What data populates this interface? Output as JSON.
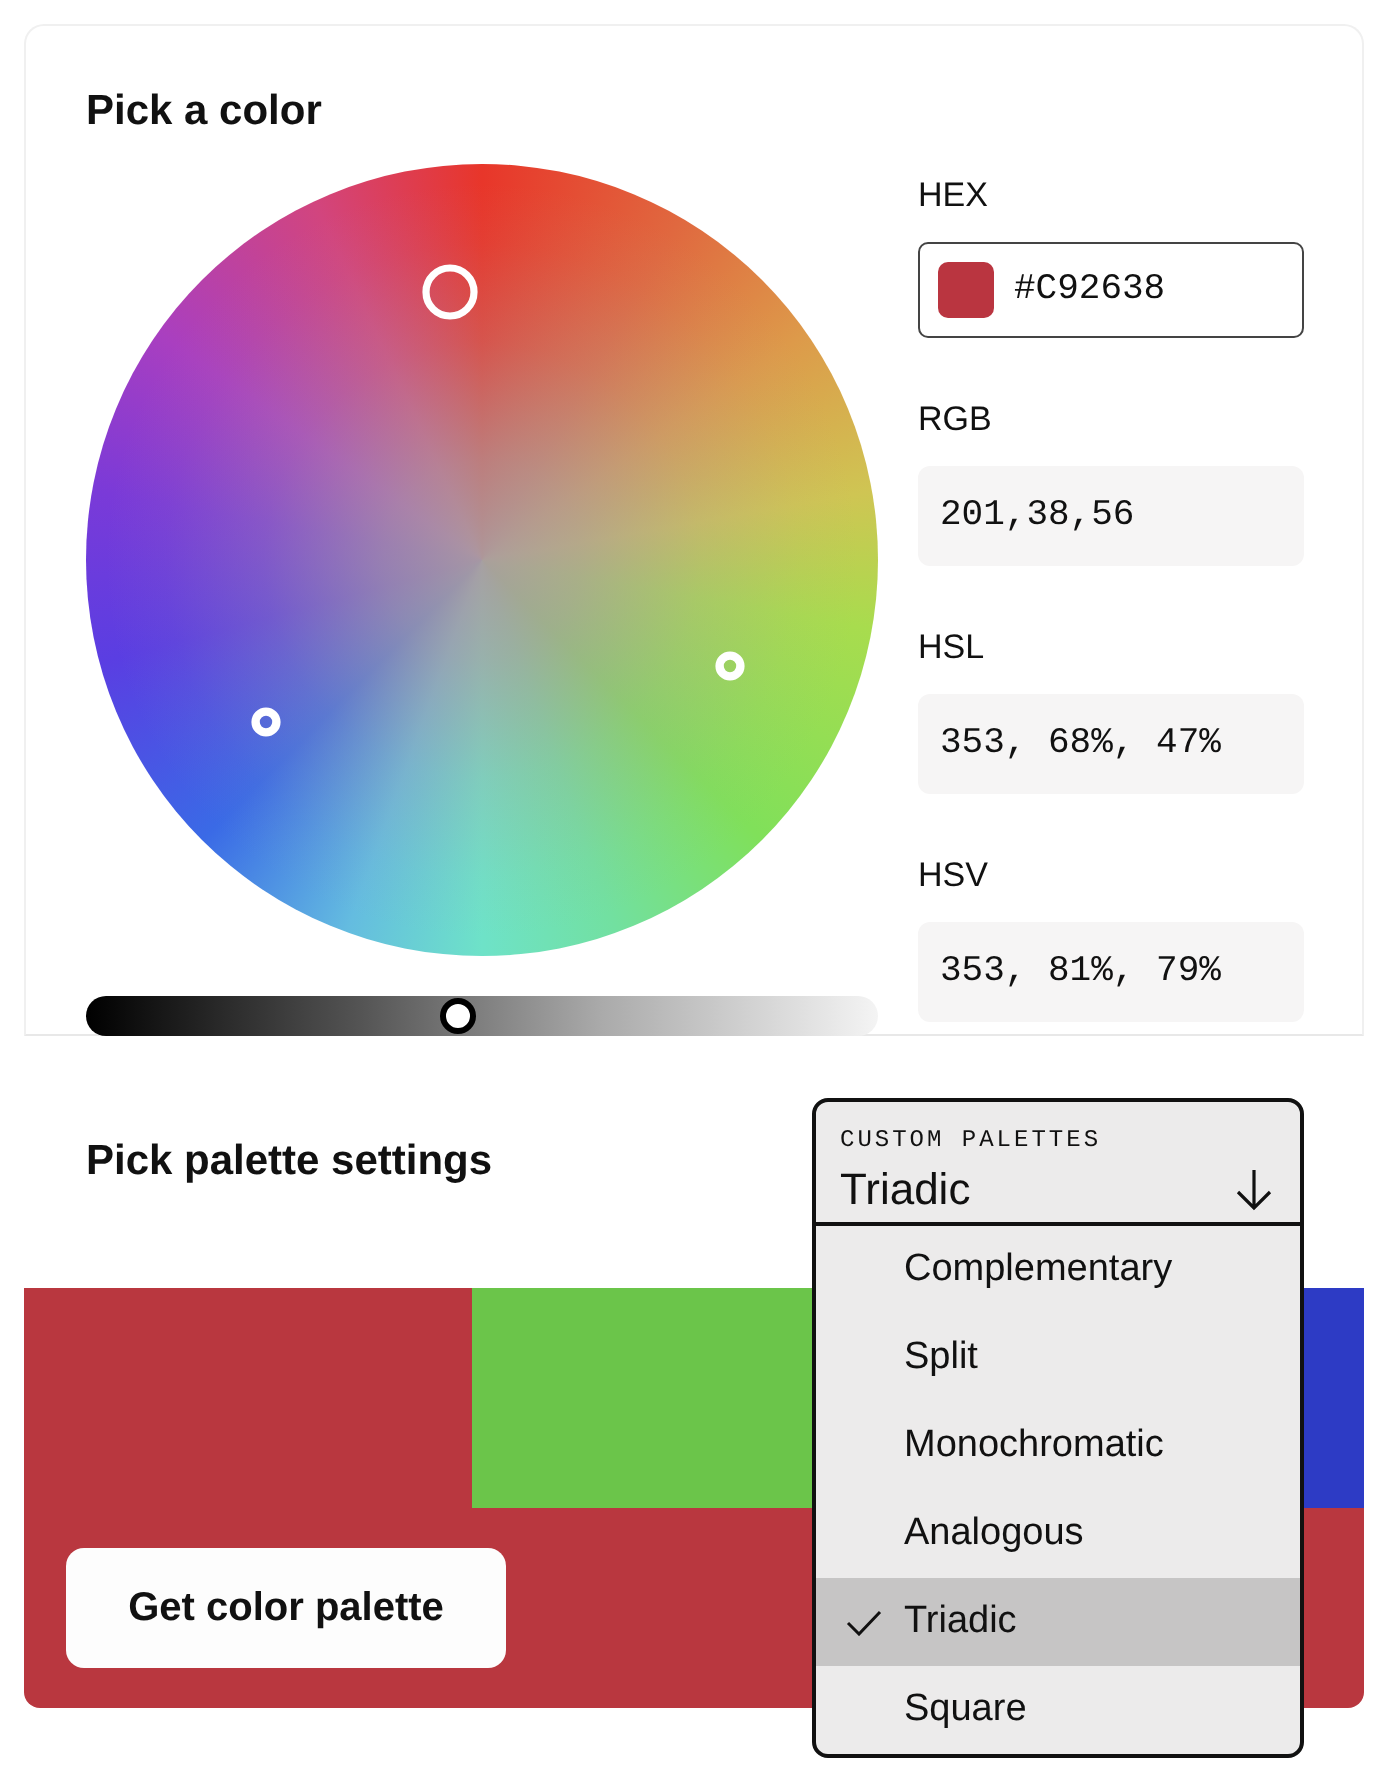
{
  "picker": {
    "title": "Pick a color",
    "markers": [
      {
        "kind": "main"
      },
      {
        "kind": "secondary"
      },
      {
        "kind": "secondary"
      }
    ],
    "lightness_slider": {
      "level": 0.47
    },
    "fields": [
      {
        "kind": "input",
        "label": "HEX",
        "value": "#C92638",
        "color": "#ba3540"
      },
      {
        "kind": "readout",
        "label": "RGB",
        "value": "201,38,56"
      },
      {
        "kind": "readout",
        "label": "HSL",
        "value": "353, 68%, 47%"
      },
      {
        "kind": "readout",
        "label": "HSV",
        "value": "353, 81%, 79%"
      }
    ]
  },
  "palette_settings": {
    "title": "Pick palette settings",
    "dropdown": {
      "label": "CUSTOM PALETTES",
      "value": "Triadic",
      "expanded": true,
      "options": [
        {
          "label": "Complementary",
          "selected": false
        },
        {
          "label": "Split",
          "selected": false
        },
        {
          "label": "Monochromatic",
          "selected": false
        },
        {
          "label": "Analogous",
          "selected": false
        },
        {
          "label": "Triadic",
          "selected": true
        },
        {
          "label": "Square",
          "selected": false
        }
      ]
    }
  },
  "palette": {
    "swatches": [
      {
        "color": "#b9373f"
      },
      {
        "color": "#6bc54a"
      },
      {
        "color": "#2d3bc5"
      }
    ],
    "button": "Get color palette"
  }
}
